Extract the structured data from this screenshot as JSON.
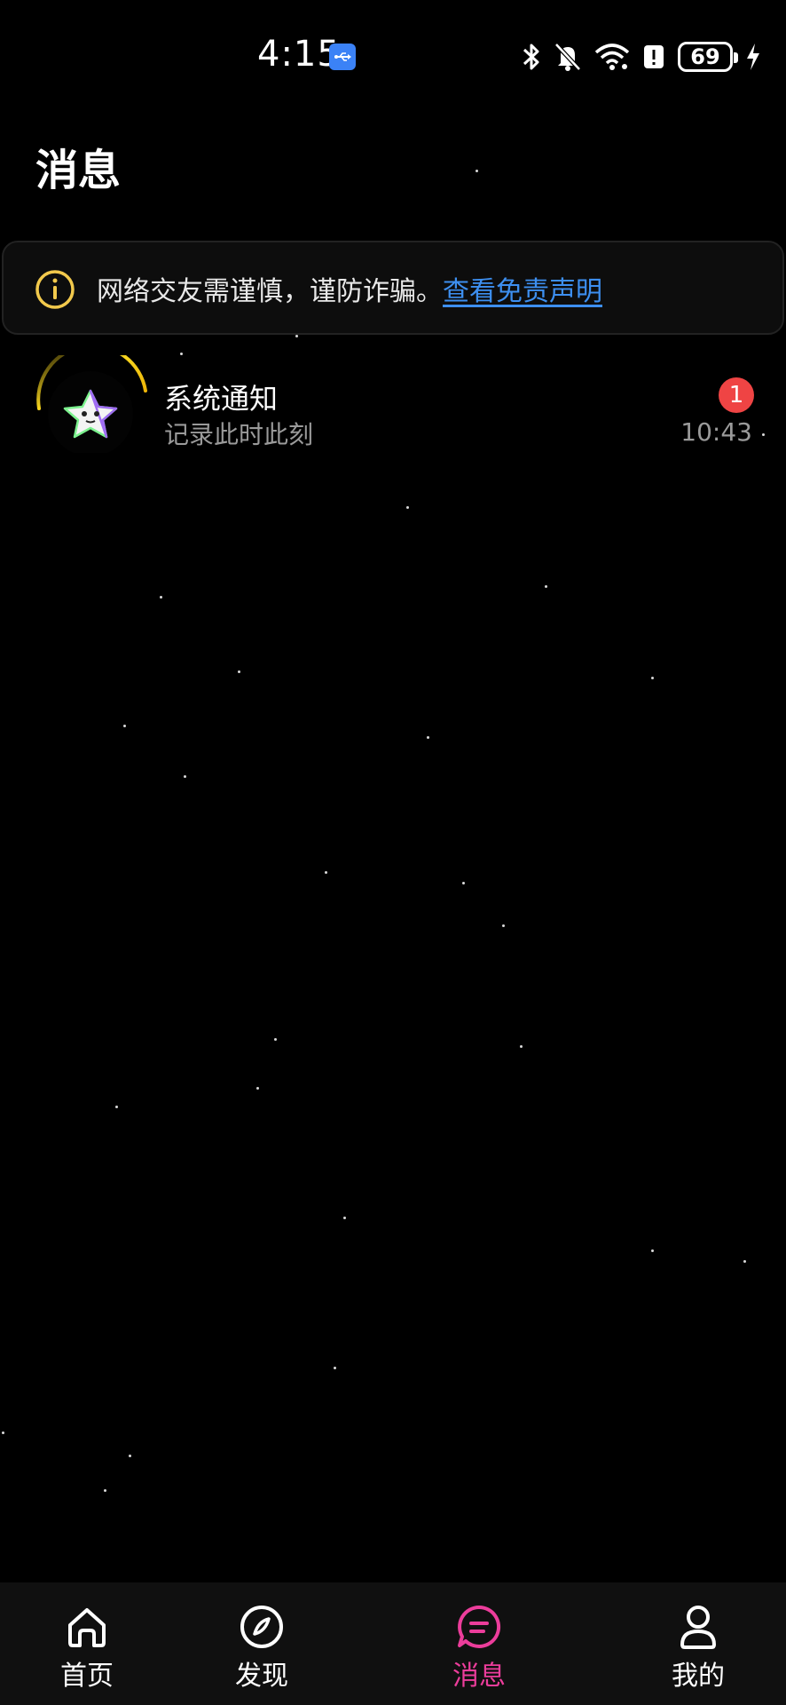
{
  "status_bar": {
    "time": "4:15",
    "battery": "69",
    "icons": [
      "usb-icon",
      "bluetooth-icon",
      "bell-off-icon",
      "wifi-icon",
      "alert-icon",
      "battery-icon",
      "charging-icon"
    ]
  },
  "page": {
    "title": "消息"
  },
  "notice": {
    "icon": "info-icon",
    "text": "网络交友需谨慎，谨防诈骗。",
    "link": "查看免责声明",
    "icon_color": "#f2c94c",
    "link_color": "#3d8ff0"
  },
  "messages": [
    {
      "title": "系统通知",
      "subtitle": "记录此时此刻",
      "badge": "1",
      "time": "10:43",
      "avatar_icon": "star-mascot-icon"
    }
  ],
  "bottom_nav": {
    "items": [
      {
        "label": "首页",
        "icon": "home-icon",
        "active": false
      },
      {
        "label": "发现",
        "icon": "compass-icon",
        "active": false
      },
      {
        "label": "消息",
        "icon": "message-icon",
        "active": true
      },
      {
        "label": "我的",
        "icon": "user-icon",
        "active": false
      }
    ],
    "active_color": "#ec3d9b"
  }
}
